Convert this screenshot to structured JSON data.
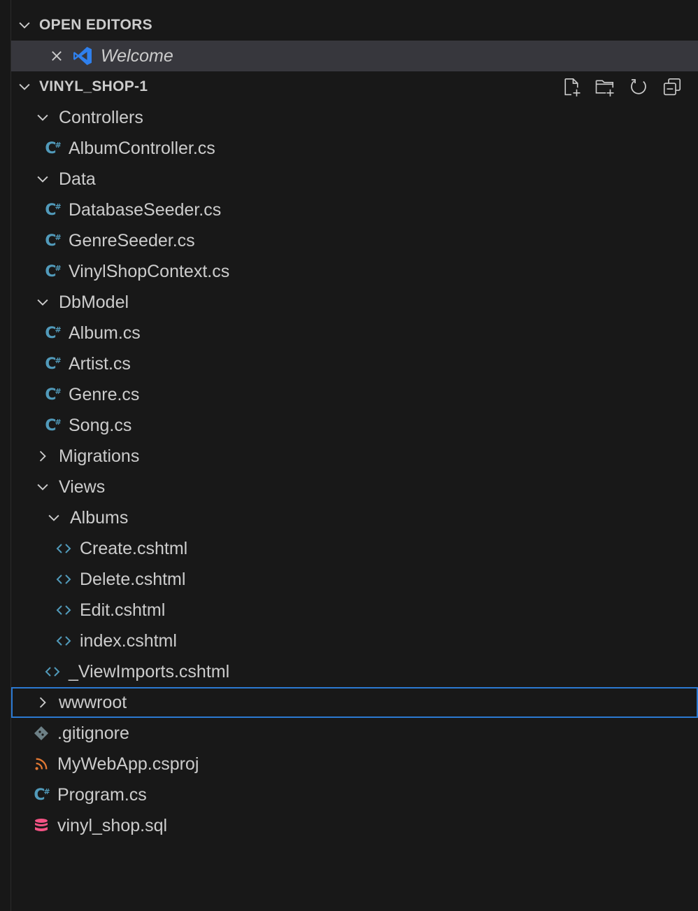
{
  "open_editors": {
    "header": "OPEN EDITORS",
    "items": [
      {
        "label": "Welcome",
        "icon": "vscode-logo-icon",
        "close_icon": "close-icon"
      }
    ]
  },
  "workspace": {
    "header": "VINYL_SHOP-1",
    "actions": [
      {
        "name": "new-file-button",
        "icon": "new-file-icon"
      },
      {
        "name": "new-folder-button",
        "icon": "new-folder-icon"
      },
      {
        "name": "refresh-button",
        "icon": "refresh-icon"
      },
      {
        "name": "collapse-all-button",
        "icon": "collapse-all-icon"
      }
    ],
    "tree": [
      {
        "label": "Controllers",
        "type": "folder",
        "expanded": true,
        "depth": 0
      },
      {
        "label": "AlbumController.cs",
        "type": "csharp",
        "depth": 1
      },
      {
        "label": "Data",
        "type": "folder",
        "expanded": true,
        "depth": 0
      },
      {
        "label": "DatabaseSeeder.cs",
        "type": "csharp",
        "depth": 1
      },
      {
        "label": "GenreSeeder.cs",
        "type": "csharp",
        "depth": 1
      },
      {
        "label": "VinylShopContext.cs",
        "type": "csharp",
        "depth": 1
      },
      {
        "label": "DbModel",
        "type": "folder",
        "expanded": true,
        "depth": 0
      },
      {
        "label": "Album.cs",
        "type": "csharp",
        "depth": 1
      },
      {
        "label": "Artist.cs",
        "type": "csharp",
        "depth": 1
      },
      {
        "label": "Genre.cs",
        "type": "csharp",
        "depth": 1
      },
      {
        "label": "Song.cs",
        "type": "csharp",
        "depth": 1
      },
      {
        "label": "Migrations",
        "type": "folder",
        "expanded": false,
        "depth": 0
      },
      {
        "label": "Views",
        "type": "folder",
        "expanded": true,
        "depth": 0
      },
      {
        "label": "Albums",
        "type": "folder",
        "expanded": true,
        "depth": 1
      },
      {
        "label": "Create.cshtml",
        "type": "cshtml",
        "depth": 2
      },
      {
        "label": "Delete.cshtml",
        "type": "cshtml",
        "depth": 2
      },
      {
        "label": "Edit.cshtml",
        "type": "cshtml",
        "depth": 2
      },
      {
        "label": "index.cshtml",
        "type": "cshtml",
        "depth": 2
      },
      {
        "label": "_ViewImports.cshtml",
        "type": "cshtml",
        "depth": 1
      },
      {
        "label": "wwwroot",
        "type": "folder",
        "expanded": false,
        "depth": 0,
        "focused": true
      },
      {
        "label": ".gitignore",
        "type": "git",
        "depth": 0
      },
      {
        "label": "MyWebApp.csproj",
        "type": "rss",
        "depth": 0
      },
      {
        "label": "Program.cs",
        "type": "csharp",
        "depth": 0
      },
      {
        "label": "vinyl_shop.sql",
        "type": "database",
        "depth": 0
      }
    ]
  },
  "colors": {
    "background": "#181818",
    "active_row": "#37373d",
    "focus_outline": "#2b79d1",
    "csharp_icon": "#519aba",
    "rss_icon": "#e37933",
    "database_icon": "#f55385",
    "git_icon": "#6d8086",
    "vscode_blue": "#2f80ed"
  }
}
